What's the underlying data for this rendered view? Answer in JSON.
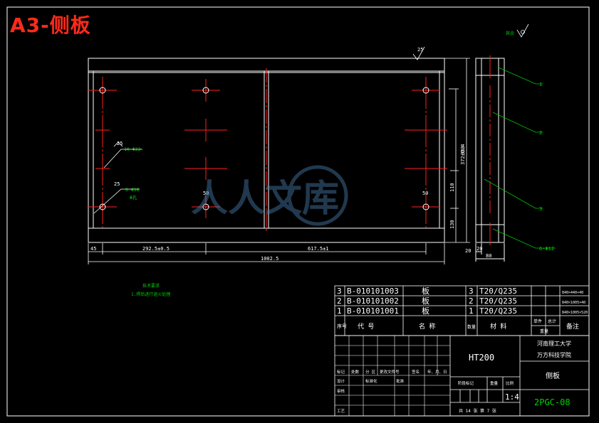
{
  "title": "A3-侧板",
  "watermark": "人人文库",
  "colors": {
    "background": "#000000",
    "outline": "#ffffff",
    "center": "#ff2020",
    "leader": "#00c800",
    "title": "#ff2a1a"
  },
  "front_view": {
    "dims": {
      "overall": "1002.5",
      "seg1": "292.5±0.5",
      "seg2": "617.5±1",
      "left_small": "45",
      "v330": "330",
      "v372": "372±0.4",
      "v110": "110",
      "v130": "130",
      "hole50a": "50",
      "hole50b": "50",
      "right_small": "20"
    },
    "notes": {
      "holes_a": "10-Φ22",
      "holes_b": "6-Φ16",
      "through": "Φ孔",
      "rough_a": "25",
      "rough_b": "25",
      "rough_top": "25"
    }
  },
  "side_view": {
    "width_dim": "80",
    "gap_dim": "20",
    "items": [
      "1",
      "2",
      "3",
      "6-Φ12"
    ],
    "rough_label": "其余"
  },
  "tech_req": {
    "heading": "技术要求",
    "line1": "1.焊后进行退火处理"
  },
  "bom": {
    "rows": [
      {
        "no": "3",
        "code": "B-010101003",
        "name": "板",
        "qty": "3",
        "material": "T20/Q235",
        "note": "840×440×40"
      },
      {
        "no": "2",
        "code": "B-010101002",
        "name": "板",
        "qty": "2",
        "material": "T20/Q235",
        "note": "840×1005×40"
      },
      {
        "no": "1",
        "code": "B-010101001",
        "name": "板",
        "qty": "1",
        "material": "T20/Q235",
        "note": "840×1005×520"
      }
    ],
    "header": {
      "no": "序号",
      "code": "代  号",
      "name": "名  称",
      "qty": "数量",
      "material": "材  料",
      "unit_weight": "单件",
      "total_weight": "总计",
      "weight": "重量",
      "note": "备注"
    }
  },
  "title_block": {
    "material": "HT200",
    "school1": "河南理工大学",
    "school2": "万方科技学院",
    "drawing_name": "侧板",
    "drawing_no": "2PGC-08",
    "scale": "1:4",
    "scale_label": "比例",
    "weight_label": "重量",
    "stage_label": "阶段标记",
    "sheet_info": "共 14 张  第 7 张",
    "rev_headers": [
      "标记",
      "处数",
      "分  区",
      "更改文件号",
      "签名",
      "年、月、日"
    ],
    "roles": [
      "设计",
      "审核",
      "工艺"
    ],
    "role_extra": [
      "标准化",
      "批准"
    ]
  }
}
